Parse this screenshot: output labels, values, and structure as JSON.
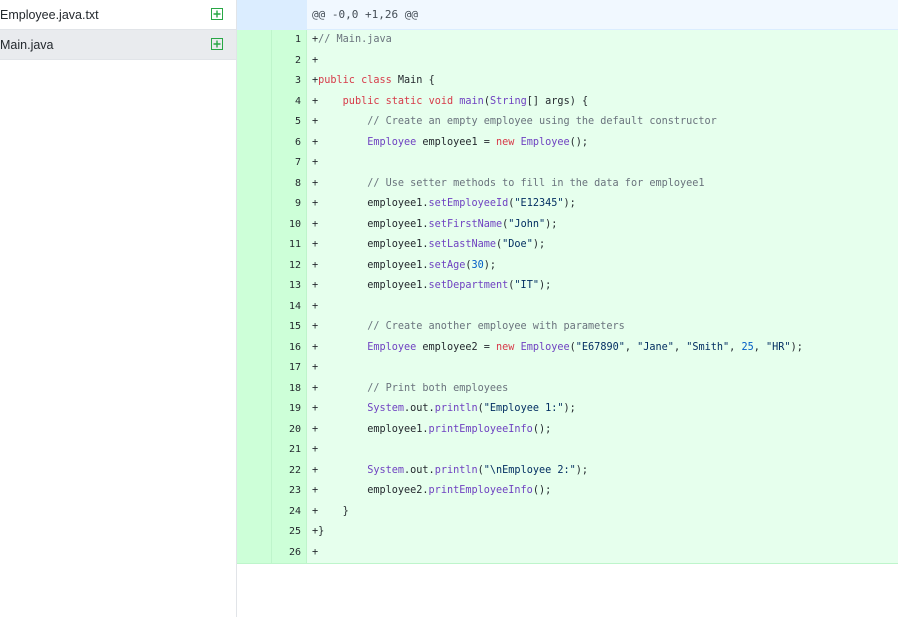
{
  "files": [
    {
      "name": "Employee.java.txt",
      "selected": false
    },
    {
      "name": "Main.java",
      "selected": true
    }
  ],
  "hunk_header": "@@ -0,0 +1,26 @@",
  "colors": {
    "added_bg": "#e6ffed",
    "added_gutter": "#cdffd8",
    "hunk_bg": "#f1f8ff",
    "add_icon": "#28a745"
  },
  "lines": [
    {
      "n": "1",
      "code": "+// Main.java"
    },
    {
      "n": "2",
      "code": "+"
    },
    {
      "n": "3",
      "code": "+public class Main {"
    },
    {
      "n": "4",
      "code": "+    public static void main(String[] args) {"
    },
    {
      "n": "5",
      "code": "+        // Create an empty employee using the default constructor"
    },
    {
      "n": "6",
      "code": "+        Employee employee1 = new Employee();"
    },
    {
      "n": "7",
      "code": "+"
    },
    {
      "n": "8",
      "code": "+        // Use setter methods to fill in the data for employee1"
    },
    {
      "n": "9",
      "code": "+        employee1.setEmployeeId(\"E12345\");"
    },
    {
      "n": "10",
      "code": "+        employee1.setFirstName(\"John\");"
    },
    {
      "n": "11",
      "code": "+        employee1.setLastName(\"Doe\");"
    },
    {
      "n": "12",
      "code": "+        employee1.setAge(30);"
    },
    {
      "n": "13",
      "code": "+        employee1.setDepartment(\"IT\");"
    },
    {
      "n": "14",
      "code": "+"
    },
    {
      "n": "15",
      "code": "+        // Create another employee with parameters"
    },
    {
      "n": "16",
      "code": "+        Employee employee2 = new Employee(\"E67890\", \"Jane\", \"Smith\", 25, \"HR\");"
    },
    {
      "n": "17",
      "code": "+"
    },
    {
      "n": "18",
      "code": "+        // Print both employees"
    },
    {
      "n": "19",
      "code": "+        System.out.println(\"Employee 1:\");"
    },
    {
      "n": "20",
      "code": "+        employee1.printEmployeeInfo();"
    },
    {
      "n": "21",
      "code": "+"
    },
    {
      "n": "22",
      "code": "+        System.out.println(\"\\nEmployee 2:\");"
    },
    {
      "n": "23",
      "code": "+        employee2.printEmployeeInfo();"
    },
    {
      "n": "24",
      "code": "+    }"
    },
    {
      "n": "25",
      "code": "+}"
    },
    {
      "n": "26",
      "code": "+"
    }
  ]
}
